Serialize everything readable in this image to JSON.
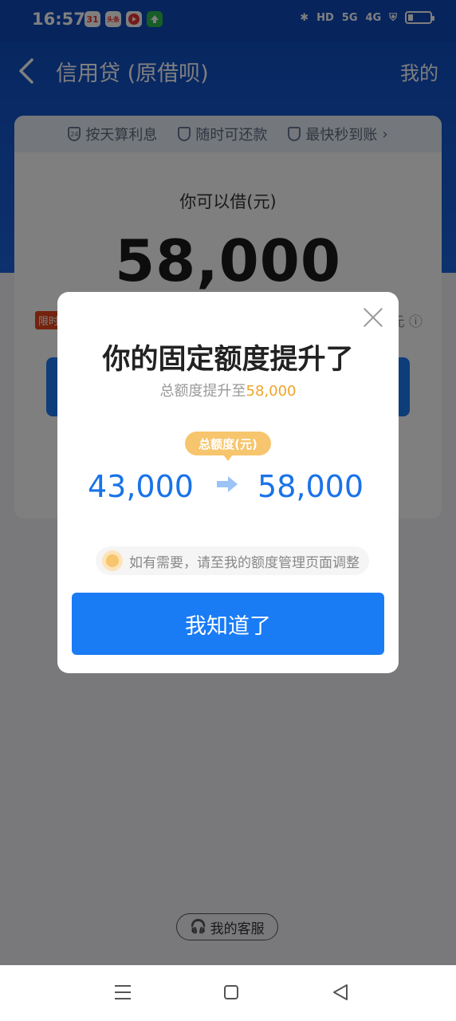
{
  "status_bar": {
    "time": "16:57",
    "notifications": [
      "31",
      "头条"
    ],
    "network_labels": [
      "HD",
      "5G",
      "4G"
    ]
  },
  "nav": {
    "title": "信用贷 (原借呗)",
    "right_link": "我的"
  },
  "card": {
    "features": [
      "按天算利息",
      "随时可还款",
      "最快秒到账"
    ],
    "label": "你可以借(元)",
    "amount": "58,000",
    "tag": "限时",
    "right_fragment": "元"
  },
  "modal": {
    "title": "你的固定额度提升了",
    "subtitle_prefix": "总额度提升至",
    "subtitle_amount": "58,000",
    "badge": "总额度(元)",
    "old_amount": "43,000",
    "new_amount": "58,000",
    "notice": "如有需要，请至我的额度管理页面调整",
    "confirm_label": "我知道了"
  },
  "footer": {
    "service_label": "我的客服"
  },
  "colors": {
    "primary_blue": "#1a7cf5",
    "amount_blue": "#1a73e8",
    "accent_gold": "#f0a42c",
    "header_blue": "#0f4ec2"
  }
}
